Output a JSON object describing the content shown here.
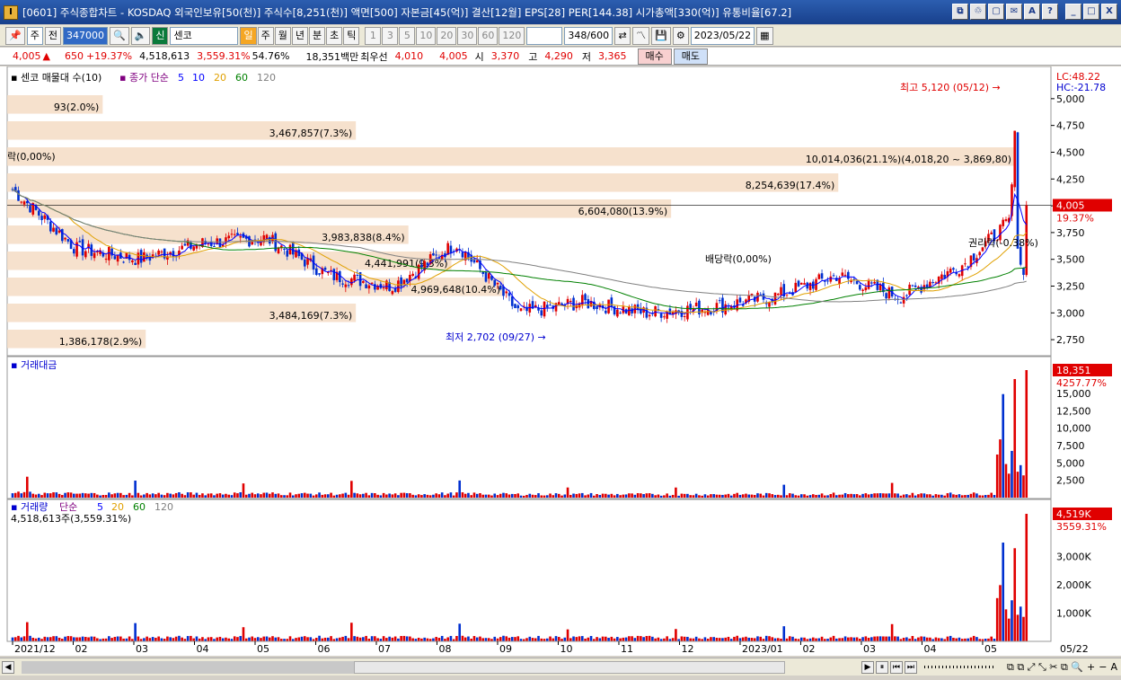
{
  "window": {
    "title": "[0601] 주식종합차트 - KOSDAQ 외국인보유[50(천)] 주식수[8,251(천)] 액면[500] 자본금[45(억)] 결산[12월] EPS[28] PER[144.38] 시가총액[330(억)] 유통비율[67.2]",
    "buttons": [
      "⧉",
      "♲",
      "▢",
      "✉",
      "A",
      "?",
      "_",
      "□",
      "X"
    ]
  },
  "toolbar": {
    "market": "주",
    "mode": "전",
    "code": "347000",
    "stock_badge": "신",
    "stock_name": "센코",
    "periods": [
      "일",
      "주",
      "월",
      "년",
      "분",
      "초",
      "틱"
    ],
    "intervals": [
      "1",
      "3",
      "5",
      "10",
      "20",
      "30",
      "60",
      "120"
    ],
    "count": "348",
    "count_max": "/600",
    "date": "2023/05/22"
  },
  "quote": {
    "price": "4,005",
    "arrow": "▲",
    "change": "650",
    "change_pct": "+19.37%",
    "volume": "4,518,613",
    "vol_ratio": "3,559.31%",
    "turnover_pct": "54.76%",
    "amount": "18,351백만",
    "bid_label": "최우선",
    "ask": "4,010",
    "bid": "4,005",
    "open_label": "시",
    "open": "3,370",
    "high_label": "고",
    "high": "4,290",
    "low_label": "저",
    "low": "3,365",
    "buy": "매수",
    "sell": "매도"
  },
  "price_pane": {
    "legend_title": "센코 매물대 수(10)",
    "ma_label": "종가 단순",
    "ma_periods": [
      {
        "p": "5",
        "c": "#0000ff"
      },
      {
        "p": "10",
        "c": "#0000ff"
      },
      {
        "p": "20",
        "c": "#e0a000"
      },
      {
        "p": "60",
        "c": "#008000"
      },
      {
        "p": "120",
        "c": "#808080"
      }
    ],
    "lc": "LC:48.22",
    "hc": "HC:-21.78",
    "yticks": [
      "5,000",
      "4,750",
      "4,500",
      "4,250",
      "4,000",
      "3,750",
      "3,500",
      "3,250",
      "3,000",
      "2,750"
    ],
    "cur_price": "4,005",
    "cur_pct": "19.37%",
    "high_ann": "최고 5,120 (05/12)",
    "low_ann": "최저 2,702 (09/27)",
    "event1": "락(0,00%)",
    "event2": "배당락(0,00%)",
    "event3": "권리락(-0.38%)",
    "volume_profile": [
      {
        "label": "93(2.0%)",
        "pct": 2.0
      },
      {
        "label": "3,467,857(7.3%)",
        "pct": 7.3
      },
      {
        "label": "10,014,036(21.1%)(4,018,20 ~ 3,869,80)",
        "pct": 21.1
      },
      {
        "label": "8,254,639(17.4%)",
        "pct": 17.4
      },
      {
        "label": "6,604,080(13.9%)",
        "pct": 13.9
      },
      {
        "label": "3,983,838(8.4%)",
        "pct": 8.4
      },
      {
        "label": "4,441,991(9.3%)",
        "pct": 9.3
      },
      {
        "label": "4,969,648(10.4%)",
        "pct": 10.4
      },
      {
        "label": "3,484,169(7.3%)",
        "pct": 7.3
      },
      {
        "label": "1,386,178(2.9%)",
        "pct": 2.9
      }
    ]
  },
  "amount_pane": {
    "title": "거래대금",
    "yticks": [
      "15,000",
      "12,500",
      "10,000",
      "7,500",
      "5,000",
      "2,500"
    ],
    "cur": "18,351",
    "cur_pct": "4257.77%"
  },
  "volume_pane": {
    "title": "거래량",
    "ma_label": "단순",
    "ma_periods": [
      "5",
      "20",
      "60",
      "120"
    ],
    "sub": "4,518,613주(3,559.31%)",
    "yticks": [
      "3,000K",
      "2,000K",
      "1,000K"
    ],
    "cur": "4,519K",
    "cur_pct": "3559.31%"
  },
  "xaxis": [
    "2021/12",
    "02",
    "03",
    "04",
    "05",
    "06",
    "07",
    "08",
    "09",
    "10",
    "11",
    "12",
    "2023/01",
    "02",
    "03",
    "04",
    "05"
  ],
  "xaxis_end": "05/22",
  "footer_tools": [
    "▶",
    "⏸",
    "⏮",
    "⏭",
    "+",
    "−",
    "A"
  ],
  "chart_data": {
    "type": "candlestick",
    "period": "daily",
    "y_range": [
      2600,
      5200
    ],
    "high": {
      "value": 5120,
      "date": "05/12"
    },
    "low": {
      "value": 2702,
      "date": "09/27"
    },
    "last_close": 4005,
    "monthly_closes_approx": [
      {
        "m": "2021/12",
        "v": 4150
      },
      {
        "m": "02",
        "v": 3600
      },
      {
        "m": "03",
        "v": 3500
      },
      {
        "m": "04",
        "v": 3650
      },
      {
        "m": "05",
        "v": 3700
      },
      {
        "m": "06",
        "v": 3350
      },
      {
        "m": "07",
        "v": 3250
      },
      {
        "m": "08",
        "v": 3650
      },
      {
        "m": "09",
        "v": 3000
      },
      {
        "m": "10",
        "v": 3100
      },
      {
        "m": "11",
        "v": 3000
      },
      {
        "m": "12",
        "v": 3050
      },
      {
        "m": "2023/01",
        "v": 3150
      },
      {
        "m": "02",
        "v": 3350
      },
      {
        "m": "03",
        "v": 3150
      },
      {
        "m": "04",
        "v": 3450
      },
      {
        "m": "05",
        "v": 4005
      }
    ]
  }
}
